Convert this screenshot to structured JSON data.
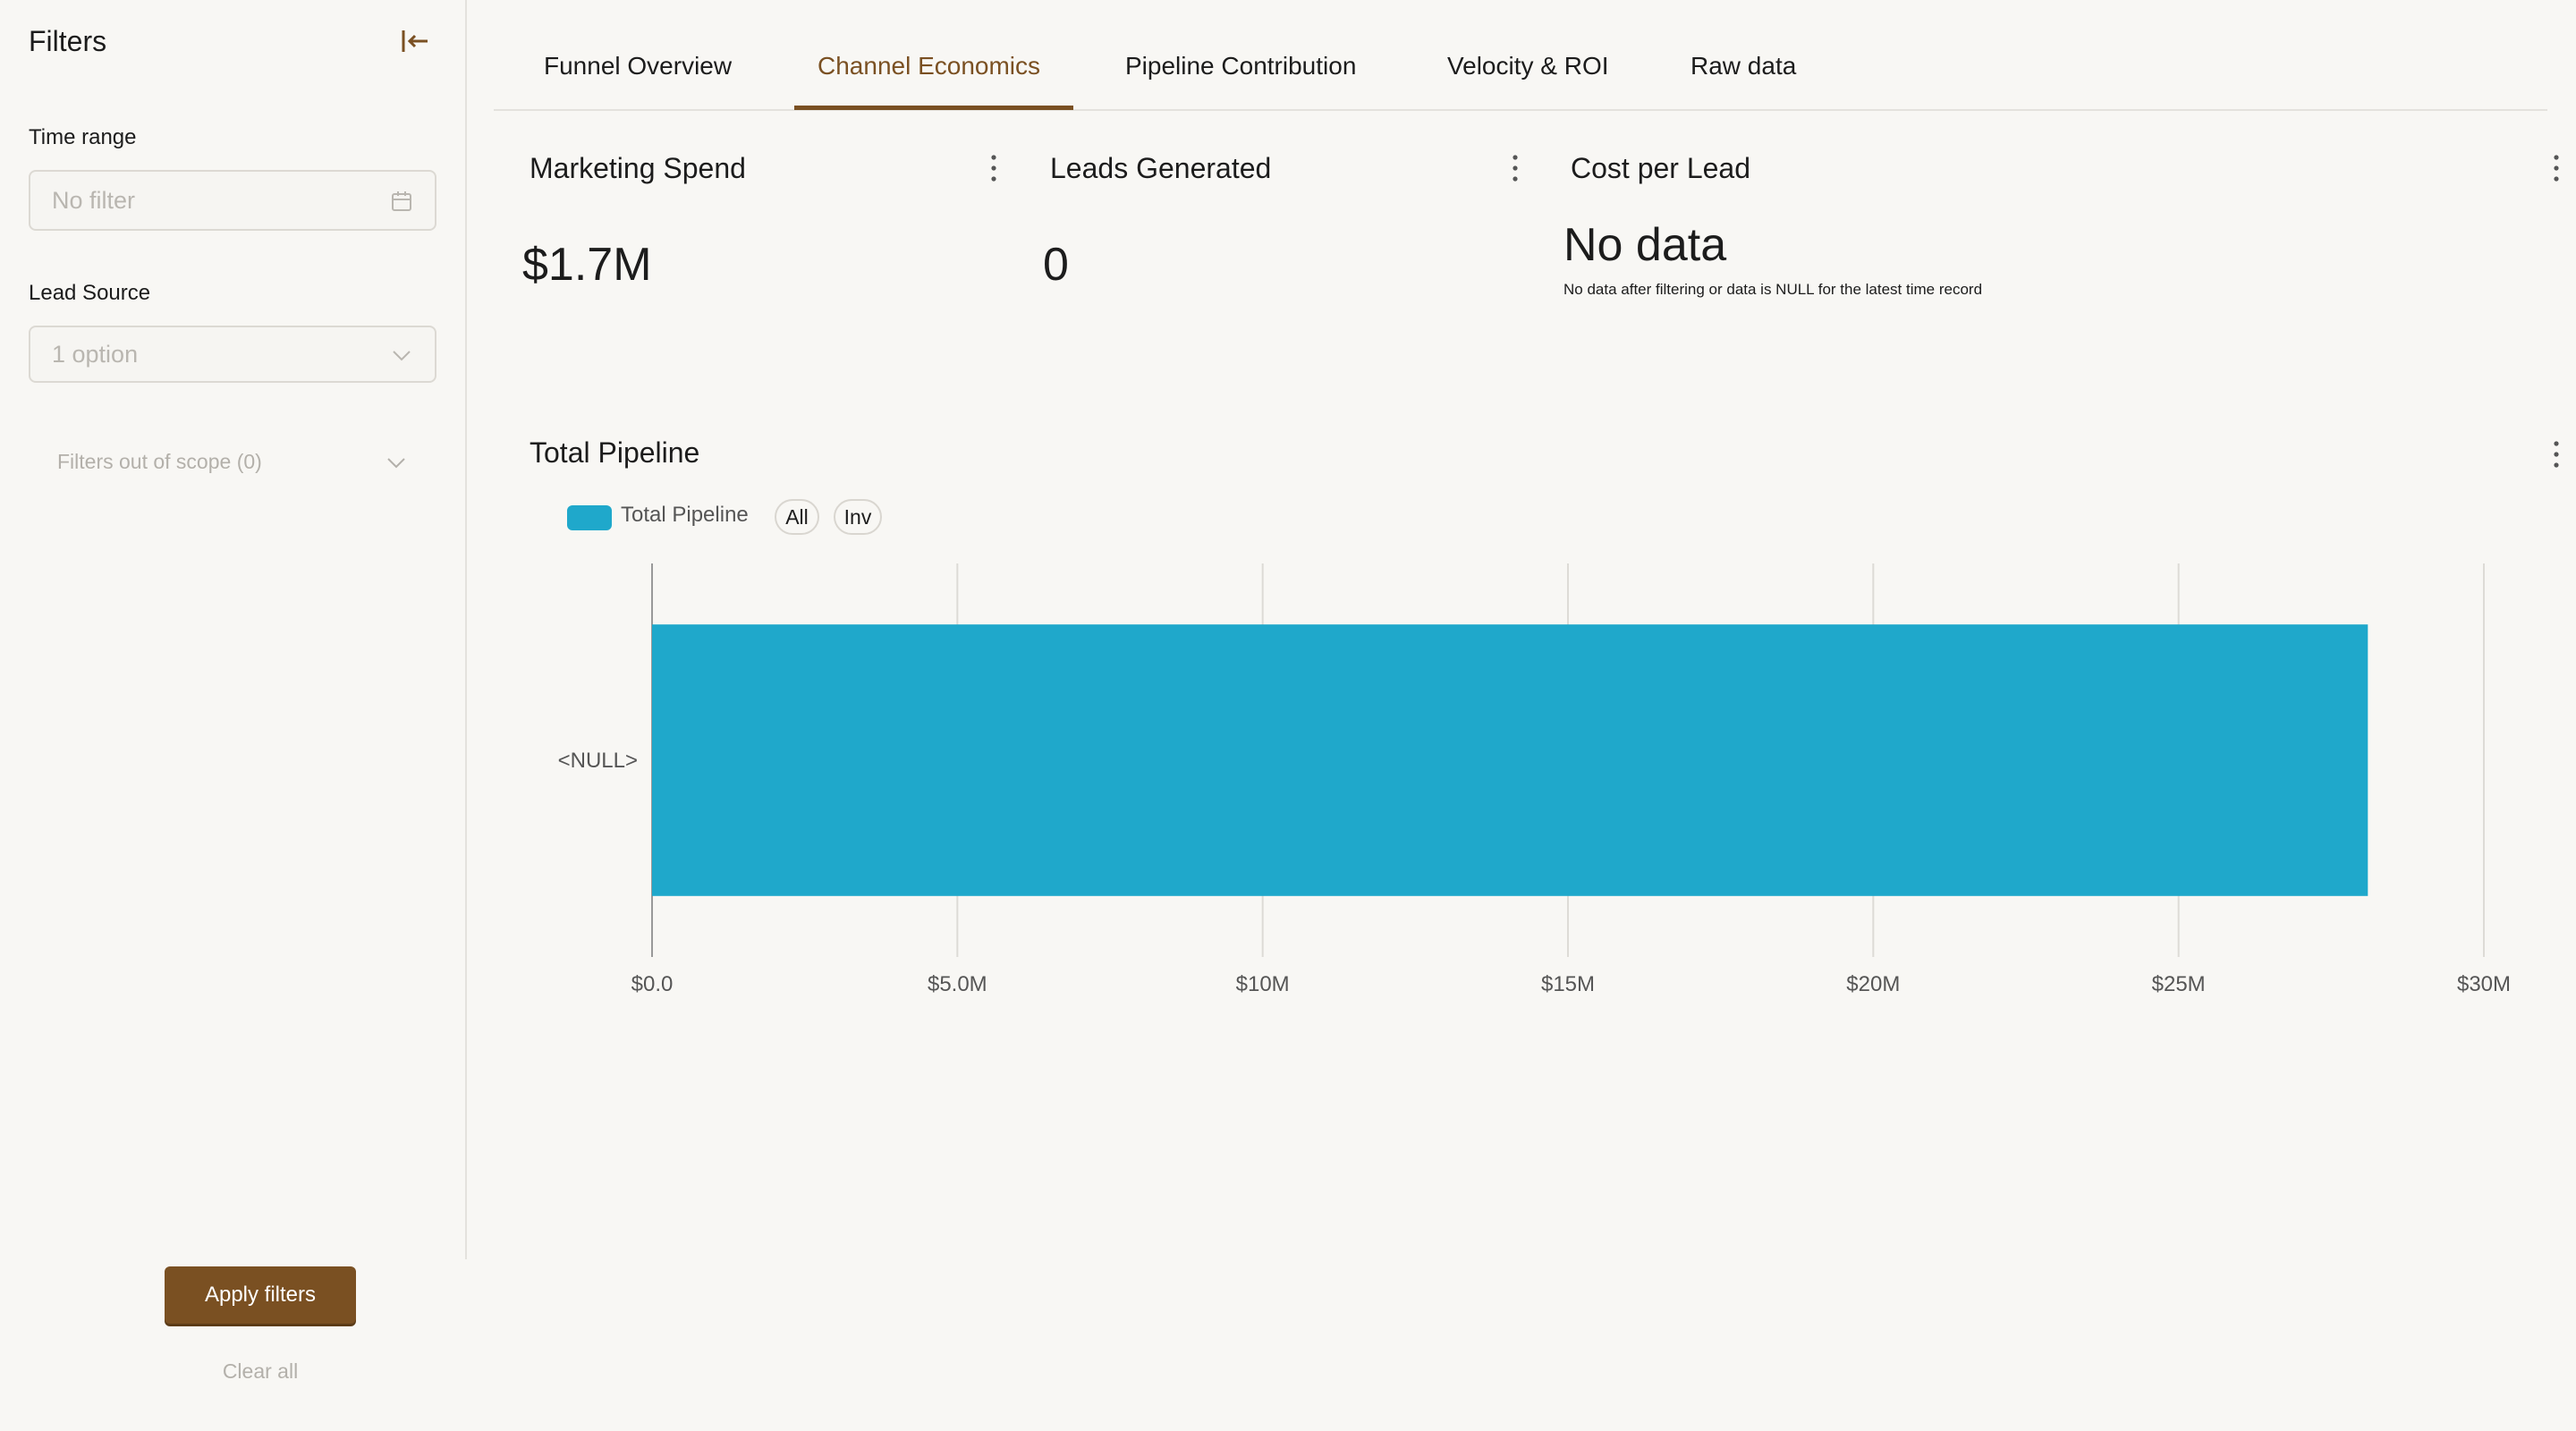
{
  "sidebar": {
    "title": "Filters",
    "time_range": {
      "label": "Time range",
      "placeholder": "No filter"
    },
    "lead_source": {
      "label": "Lead Source",
      "placeholder": "1 option"
    },
    "out_of_scope": "Filters out of scope (0)",
    "apply_label": "Apply filters",
    "clear_label": "Clear all"
  },
  "tabs": [
    {
      "label": "Funnel Overview",
      "active": false
    },
    {
      "label": "Channel Economics",
      "active": true
    },
    {
      "label": "Pipeline Contribution",
      "active": false
    },
    {
      "label": "Velocity & ROI",
      "active": false
    },
    {
      "label": "Raw data",
      "active": false
    }
  ],
  "kpis": [
    {
      "title": "Marketing Spend",
      "value": "$1.7M"
    },
    {
      "title": "Leads Generated",
      "value": "0"
    },
    {
      "title": "Cost per Lead",
      "value": "No data",
      "note": "No data after filtering or data is NULL for the latest time record"
    }
  ],
  "chart": {
    "title": "Total Pipeline",
    "legend_label": "Total Pipeline",
    "legend_all": "All",
    "legend_inv": "Inv"
  },
  "colors": {
    "accent": "#7a5022",
    "bar": "#1fa8cb",
    "background": "#f8f7f4"
  },
  "chart_data": {
    "type": "bar",
    "orientation": "horizontal",
    "title": "Total Pipeline",
    "categories": [
      "<NULL>"
    ],
    "series": [
      {
        "name": "Total Pipeline",
        "values": [
          28100000
        ]
      }
    ],
    "x_ticks": [
      "$0.0",
      "$5.0M",
      "$10M",
      "$15M",
      "$20M",
      "$25M",
      "$30M"
    ],
    "xlim": [
      0,
      30000000
    ],
    "grid": true,
    "legend_position": "top-left"
  }
}
